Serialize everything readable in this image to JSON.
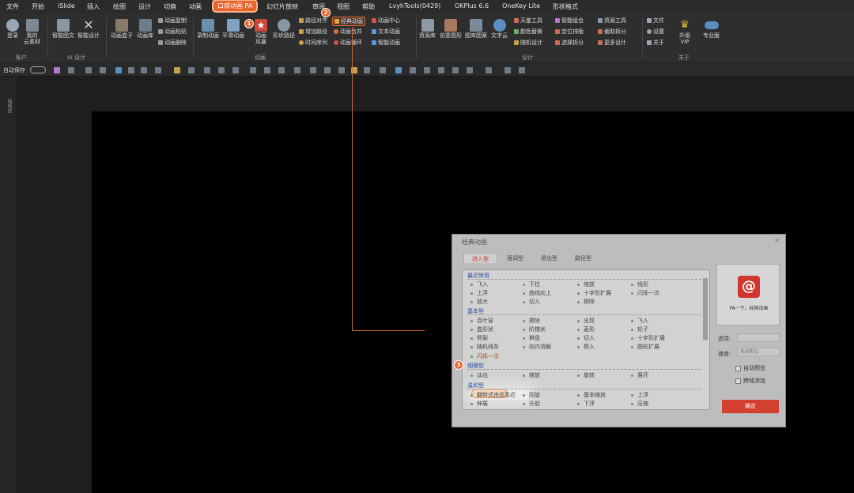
{
  "menu": [
    "文件",
    "开始",
    "iSlide",
    "插入",
    "绘图",
    "设计",
    "切换",
    "动画",
    "口袋动画 PA",
    "幻灯片放映",
    "审阅",
    "视图",
    "帮助",
    "LvyhTools(0429)",
    "OKPlus 6.6",
    "OneKey Lite",
    "形状格式"
  ],
  "ribbon": {
    "login": "登录",
    "cloud": "我的\n云素材",
    "smart_graphic": "智能图文",
    "smart_design": "智能设计",
    "anim_box": "动画盒子",
    "anim_lib": "动画库",
    "anim_copy": "动画复制",
    "anim_paste": "动画粘贴",
    "anim_delete": "动画删除",
    "record_anim": "录制动画",
    "smooth_anim": "平滑动画",
    "anim_style": "动画\n风暴",
    "path_tool": "形状路径",
    "path_align": "路径对齐",
    "path_reverse": "增加路径",
    "time_seq": "时间序列",
    "classic_anim": "经典动画",
    "anim_merge": "动画合并",
    "anim_loop": "动画循环",
    "anim_center": "动画中心",
    "text_anim": "文本动画",
    "smart_anim": "智能动画",
    "res_lib": "资源库",
    "creative": "创意图形",
    "img_process": "图库图案",
    "text_cloud": "文字云",
    "sky_tools": "天鉴工具",
    "color_replace": "颜色替换",
    "random_design": "随机设计",
    "smart_group": "智能组合",
    "locate_layout": "定位排版",
    "select_split": "选择拆分",
    "res_tools": "资源工具",
    "text_split": "截取拆分",
    "more_design": "更多设计",
    "file": "文件",
    "settings": "设置",
    "about": "关于",
    "upgrade_vip": "升级\nVIP",
    "pro": "专业版",
    "groups": {
      "account": "账户",
      "ai": "AI 设计",
      "anim": "动画",
      "design": "设计",
      "about": "关于"
    }
  },
  "qat": {
    "autosave": "自动保存"
  },
  "leftpane": {
    "label": "缩略图"
  },
  "badges": [
    "1",
    "2",
    "3"
  ],
  "dialog": {
    "title": "经典动画",
    "close": "×",
    "tabs": [
      "进入型",
      "强调型",
      "退出型",
      "路径型"
    ],
    "categories": {
      "recent": "最近常用",
      "basic": "基本型",
      "subtle": "细微型",
      "moderate": "温和型"
    },
    "recent": [
      "飞入",
      "下拉",
      "缩放",
      "线形",
      "上浮",
      "曲线向上",
      "十字形扩展",
      "闪烁一次",
      "放大",
      "切入",
      "擦除"
    ],
    "basic": [
      "百叶窗",
      "擦除",
      "出现",
      "飞入",
      "盒形状",
      "阶梯状",
      "菱形",
      "轮子",
      "劈裂",
      "棋盘",
      "切入",
      "十字形扩展",
      "随机线条",
      "向内溶解",
      "楔入",
      "圆形扩展",
      "闪烁一次"
    ],
    "subtle": [
      "淡出",
      "缩放",
      "旋转",
      "展开"
    ],
    "moderate": [
      "翻转式由远及近",
      "回旋",
      "基本缩放",
      "上浮",
      "伸展",
      "升起",
      "下浮",
      "压缩"
    ],
    "preview_text": "PA一下，经典动画",
    "option_label": "选项:",
    "speed_label": "速度:",
    "speed_value": "系统默认",
    "auto_preview": "自动预览",
    "cross_add": "跨域添加",
    "ok": "确定"
  },
  "colors": {
    "accent": "#e8642c",
    "ok": "#d44030"
  }
}
